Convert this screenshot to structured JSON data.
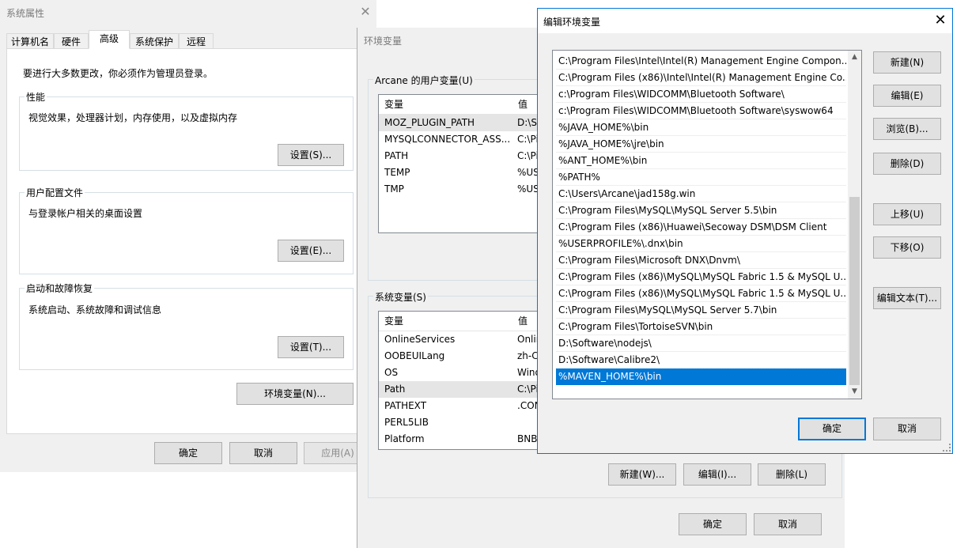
{
  "sysprops": {
    "title": "系统属性",
    "tabs": [
      "计算机名",
      "硬件",
      "高级",
      "系统保护",
      "远程"
    ],
    "admin_note": "要进行大多数更改，你必须作为管理员登录。",
    "perf": {
      "label": "性能",
      "desc": "视觉效果，处理器计划，内存使用，以及虚拟内存",
      "btn": "设置(S)..."
    },
    "profile": {
      "label": "用户配置文件",
      "desc": "与登录帐户相关的桌面设置",
      "btn": "设置(E)..."
    },
    "startup": {
      "label": "启动和故障恢复",
      "desc": "系统启动、系统故障和调试信息",
      "btn": "设置(T)..."
    },
    "env_btn": "环境变量(N)...",
    "ok": "确定",
    "cancel": "取消",
    "apply": "应用(A)"
  },
  "envvars": {
    "title": "环境变量",
    "user_label": "Arcane 的用户变量(U)",
    "col_var": "变量",
    "col_val": "值",
    "user_vars": [
      {
        "name": "MOZ_PLUGIN_PATH",
        "val": "D:\\S"
      },
      {
        "name": "MYSQLCONNECTOR_ASS...",
        "val": "C:\\Pi"
      },
      {
        "name": "PATH",
        "val": "C:\\Pi"
      },
      {
        "name": "TEMP",
        "val": "%US"
      },
      {
        "name": "TMP",
        "val": "%US"
      }
    ],
    "sys_label": "系统变量(S)",
    "sys_vars": [
      {
        "name": "OnlineServices",
        "val": "Onlin"
      },
      {
        "name": "OOBEUILang",
        "val": "zh-C"
      },
      {
        "name": "OS",
        "val": "Wind"
      },
      {
        "name": "Path",
        "val": "C:\\Pi"
      },
      {
        "name": "PATHEXT",
        "val": ".CON"
      },
      {
        "name": "PERL5LIB",
        "val": ""
      },
      {
        "name": "Platform",
        "val": "BNB"
      }
    ],
    "new": "新建(W)...",
    "edit": "编辑(I)...",
    "delete": "删除(L)",
    "ok": "确定",
    "cancel": "取消"
  },
  "editenv": {
    "title": "编辑环境变量",
    "entries": [
      "C:\\Program Files\\Intel\\Intel(R) Management Engine Compon...",
      "C:\\Program Files (x86)\\Intel\\Intel(R) Management Engine Co...",
      "c:\\Program Files\\WIDCOMM\\Bluetooth Software\\",
      "c:\\Program Files\\WIDCOMM\\Bluetooth Software\\syswow64",
      "%JAVA_HOME%\\bin",
      "%JAVA_HOME%\\jre\\bin",
      "%ANT_HOME%\\bin",
      "%PATH%",
      "C:\\Users\\Arcane\\jad158g.win",
      "C:\\Program Files\\MySQL\\MySQL Server 5.5\\bin",
      "C:\\Program Files (x86)\\Huawei\\Secoway DSM\\DSM Client",
      "%USERPROFILE%\\.dnx\\bin",
      "C:\\Program Files\\Microsoft DNX\\Dnvm\\",
      "C:\\Program Files (x86)\\MySQL\\MySQL Fabric 1.5 & MySQL U...",
      "C:\\Program Files (x86)\\MySQL\\MySQL Fabric 1.5 & MySQL U...",
      "C:\\Program Files\\MySQL\\MySQL Server 5.7\\bin",
      "C:\\Program Files\\TortoiseSVN\\bin",
      "D:\\Software\\nodejs\\",
      "D:\\Software\\Calibre2\\",
      "%MAVEN_HOME%\\bin"
    ],
    "selected_index": 19,
    "new": "新建(N)",
    "edit": "编辑(E)",
    "browse": "浏览(B)...",
    "delete": "删除(D)",
    "moveup": "上移(U)",
    "movedown": "下移(O)",
    "edittext": "编辑文本(T)...",
    "ok": "确定",
    "cancel": "取消",
    "accent": "#0078d7"
  }
}
